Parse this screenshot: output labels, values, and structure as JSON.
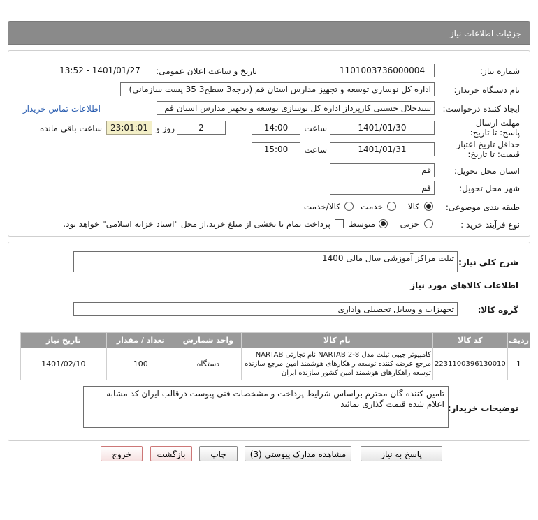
{
  "header": {
    "title": "جزئیات اطلاعات نیاز"
  },
  "details": {
    "need_number_label": "شماره نیاز:",
    "need_number": "1101003736000004",
    "announce_label": "تاریخ و ساعت اعلان عمومی:",
    "announce_value": "1401/01/27 - 13:52",
    "buyer_label": "نام دستگاه خریدار:",
    "buyer_value": "اداره کل نوسازی   توسعه و تجهیز مدارس استان قم (درجه3 سطح3  35 پست سازمانی)",
    "creator_label": "ایجاد کننده درخواست:",
    "creator_value": "سیدجلال حسینی کارپرداز اداره کل نوسازی   توسعه و تجهیز مدارس استان قم",
    "contact_link": "اطلاعات تماس خریدار",
    "deadline_label": "مهلت ارسال پاسخ: تا تاریخ:",
    "deadline_date": "1401/01/30",
    "time_label": "ساعت",
    "deadline_time": "14:00",
    "days_value": "2",
    "days_label": "روز و",
    "remaining_time": "23:01:01",
    "remaining_label": "ساعت باقی مانده",
    "validity_label": "حداقل تاریخ اعتبار قیمت: تا تاریخ:",
    "validity_date": "1401/01/31",
    "validity_time": "15:00",
    "province_label": "استان محل تحویل:",
    "province_value": "قم",
    "city_label": "شهر محل تحویل:",
    "city_value": "قم",
    "category_label": "طبقه بندی موضوعی:",
    "category_options": [
      "کالا",
      "خدمت",
      "کالا/خدمت"
    ],
    "category_selected": "کالا",
    "process_label": "نوع فرآیند خرید :",
    "process_options": [
      "جزیی",
      "متوسط"
    ],
    "process_selected": "متوسط",
    "treasury_note": "پرداخت تمام یا بخشی از مبلغ خرید،از محل \"اسناد خزانه اسلامی\" خواهد بود."
  },
  "summary": {
    "desc_label": "شرح کلي نياز:",
    "desc_value": "تبلت مراکز آموزشی سال مالی 1400",
    "goods_info_title": "اطلاعات کالاهاي مورد نياز",
    "group_label": "گروه کالا:",
    "group_value": "تجهیزات و وسایل تحصیلی واداری"
  },
  "table": {
    "headers": [
      "ردیف",
      "کد کالا",
      "نام کالا",
      "واحد شمارش",
      "تعداد / مقدار",
      "تاریخ نیاز"
    ],
    "rows": [
      {
        "index": "1",
        "code": "2231100396130010",
        "name": "کامپیوتر جیبی تبلت مدل NARTAB 2-8 نام تجارتی NARTAB مرجع عرضه کننده توسعه راهکارهای هوشمند امین مرجع سازنده توسعه راهکارهای هوشمند امین کشور سازنده ایران",
        "unit": "دستگاه",
        "qty": "100",
        "date": "1401/02/10"
      }
    ]
  },
  "notes": {
    "label": "توضیحات خریدار:",
    "value": "تامین کننده گان محترم براساس شرایط پرداخت و مشخصات فنی پیوست درقالب ایران کد مشابه اعلام شده قیمت گذاری نمائید"
  },
  "buttons": {
    "reply": "پاسخ به نیاز",
    "attachments": "مشاهده مدارک پیوستی (3)",
    "print": "چاپ",
    "back": "بازگشت",
    "exit": "خروج"
  }
}
